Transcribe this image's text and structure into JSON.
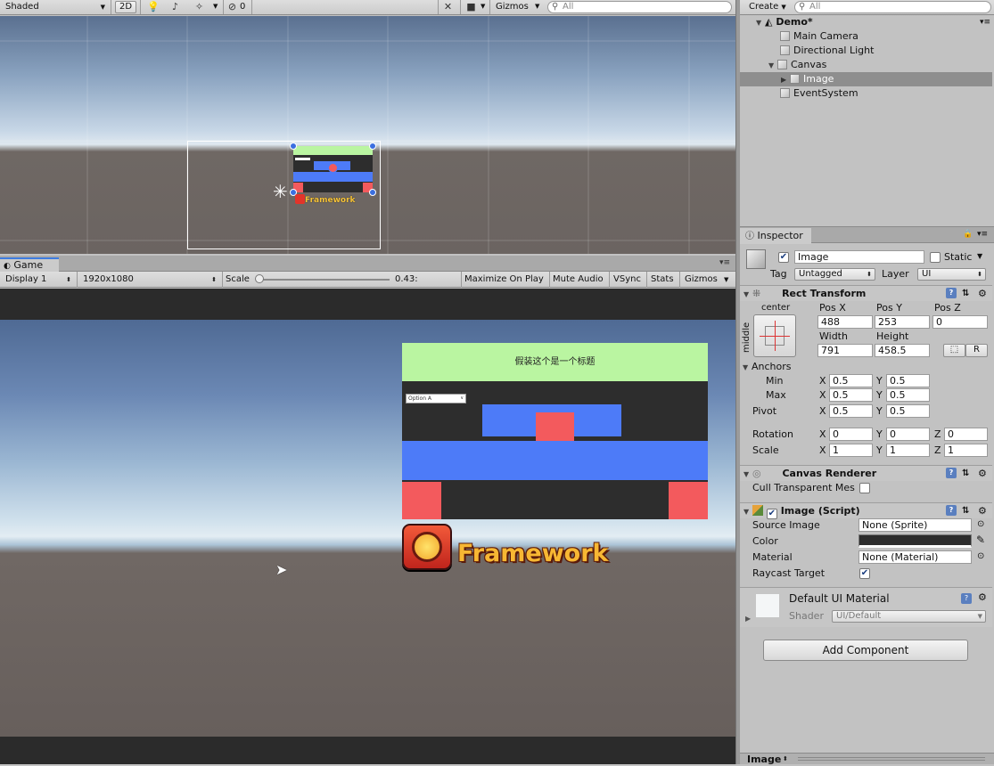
{
  "scene_toolbar": {
    "shading": "Shaded",
    "mode_2d": "2D",
    "hidden_count": "0",
    "gizmos": "Gizmos",
    "search_placeholder": "All"
  },
  "hierarchy": {
    "create": "Create",
    "search_placeholder": "All",
    "scene": "Demo*",
    "items": [
      "Main Camera",
      "Directional Light",
      "Canvas",
      "Image",
      "EventSystem"
    ]
  },
  "game": {
    "tab": "Game",
    "display": "Display 1",
    "resolution": "1920x1080",
    "scale_label": "Scale",
    "scale_value": "0.43:",
    "maximize": "Maximize On Play",
    "mute": "Mute Audio",
    "vsync": "VSync",
    "stats": "Stats",
    "gizmos": "Gizmos",
    "title_text": "假装这个是一个标题",
    "dropdown": "Option A",
    "logo_text": "Framework"
  },
  "inspector": {
    "tab": "Inspector",
    "object_name": "Image",
    "static_label": "Static",
    "tag_label": "Tag",
    "tag_value": "Untagged",
    "layer_label": "Layer",
    "layer_value": "UI",
    "rect": {
      "title": "Rect Transform",
      "anchor_top": "center",
      "anchor_side": "middle",
      "posx_label": "Pos X",
      "posy_label": "Pos Y",
      "posz_label": "Pos Z",
      "posx": "488",
      "posy": "253",
      "posz": "0",
      "width_label": "Width",
      "height_label": "Height",
      "width": "791",
      "height": "458.5",
      "r_button": "R",
      "anchors_label": "Anchors",
      "min_label": "Min",
      "max_label": "Max",
      "pivot_label": "Pivot",
      "min_x": "0.5",
      "min_y": "0.5",
      "max_x": "0.5",
      "max_y": "0.5",
      "pivot_x": "0.5",
      "pivot_y": "0.5",
      "rotation_label": "Rotation",
      "scale_label": "Scale",
      "rot_x": "0",
      "rot_y": "0",
      "rot_z": "0",
      "scale_x": "1",
      "scale_y": "1",
      "scale_z": "1",
      "x": "X",
      "y": "Y",
      "z": "Z"
    },
    "canvas_renderer": {
      "title": "Canvas Renderer",
      "cull_label": "Cull Transparent Mes"
    },
    "image_script": {
      "title": "Image (Script)",
      "source_label": "Source Image",
      "source_value": "None (Sprite)",
      "color_label": "Color",
      "material_label": "Material",
      "material_value": "None (Material)",
      "raycast_label": "Raycast Target"
    },
    "material": {
      "name": "Default UI Material",
      "shader_label": "Shader",
      "shader_value": "UI/Default"
    },
    "add_component": "Add Component",
    "preview_label": "Image"
  },
  "colors": {
    "panel": "#c2c2c2",
    "selected_row": "#8e8e8e",
    "title_green": "#baf5a1",
    "blue": "#4d7bf8",
    "red": "#f35a5d",
    "dark": "#2d2d2d"
  }
}
